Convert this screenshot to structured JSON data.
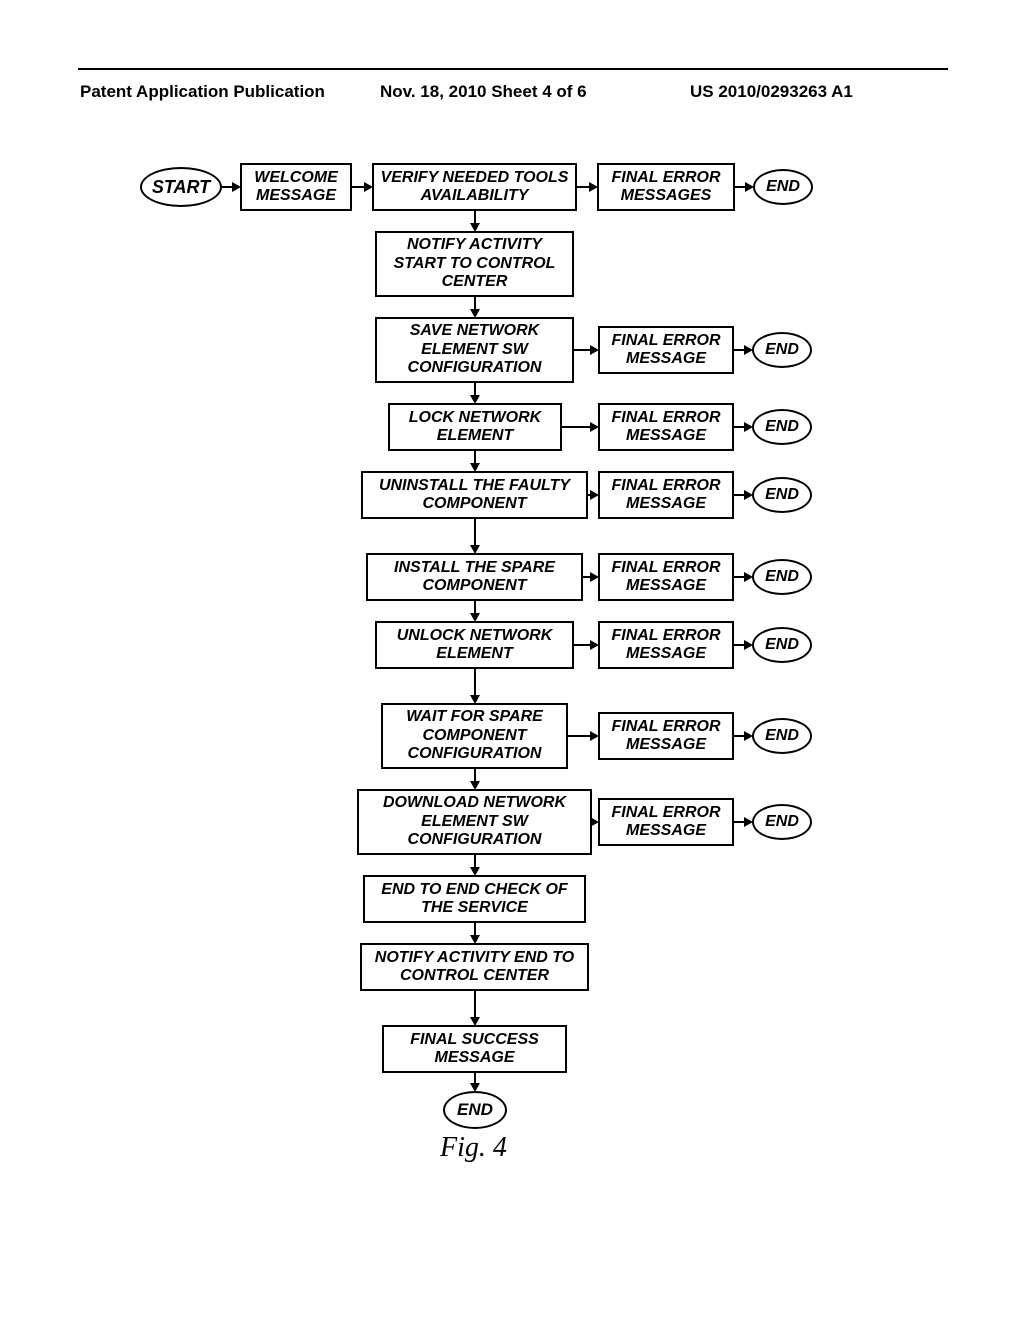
{
  "header": {
    "left": "Patent Application Publication",
    "center": "Nov. 18, 2010  Sheet 4 of 6",
    "right": "US 2010/0293263 A1"
  },
  "figure_caption": "Fig. 4",
  "nodes": {
    "start": "START",
    "welcome": "WELCOME MESSAGE",
    "verify": "VERIFY NEEDED TOOLS AVAILABILITY",
    "err_verify": "FINAL ERROR MESSAGES",
    "end_verify": "END",
    "notify_start": "NOTIFY ACTIVITY START TO CONTROL CENTER",
    "save_cfg": "SAVE NETWORK ELEMENT SW CONFIGURATION",
    "err_save": "FINAL ERROR MESSAGE",
    "end_save": "END",
    "lock": "LOCK NETWORK ELEMENT",
    "err_lock": "FINAL ERROR MESSAGE",
    "end_lock": "END",
    "uninstall": "UNINSTALL THE FAULTY COMPONENT",
    "err_uninstall": "FINAL ERROR MESSAGE",
    "end_uninstall": "END",
    "install": "INSTALL THE SPARE COMPONENT",
    "err_install": "FINAL ERROR MESSAGE",
    "end_install": "END",
    "unlock": "UNLOCK NETWORK ELEMENT",
    "err_unlock": "FINAL ERROR MESSAGE",
    "end_unlock": "END",
    "wait": "WAIT FOR SPARE COMPONENT CONFIGURATION",
    "err_wait": "FINAL ERROR MESSAGE",
    "end_wait": "END",
    "download": "DOWNLOAD NETWORK ELEMENT SW CONFIGURATION",
    "err_download": "FINAL ERROR MESSAGE",
    "end_download": "END",
    "e2e": "END TO END CHECK OF THE SERVICE",
    "notify_end": "NOTIFY ACTIVITY END TO CONTROL CENTER",
    "success": "FINAL SUCCESS MESSAGE",
    "end_success": "END"
  }
}
